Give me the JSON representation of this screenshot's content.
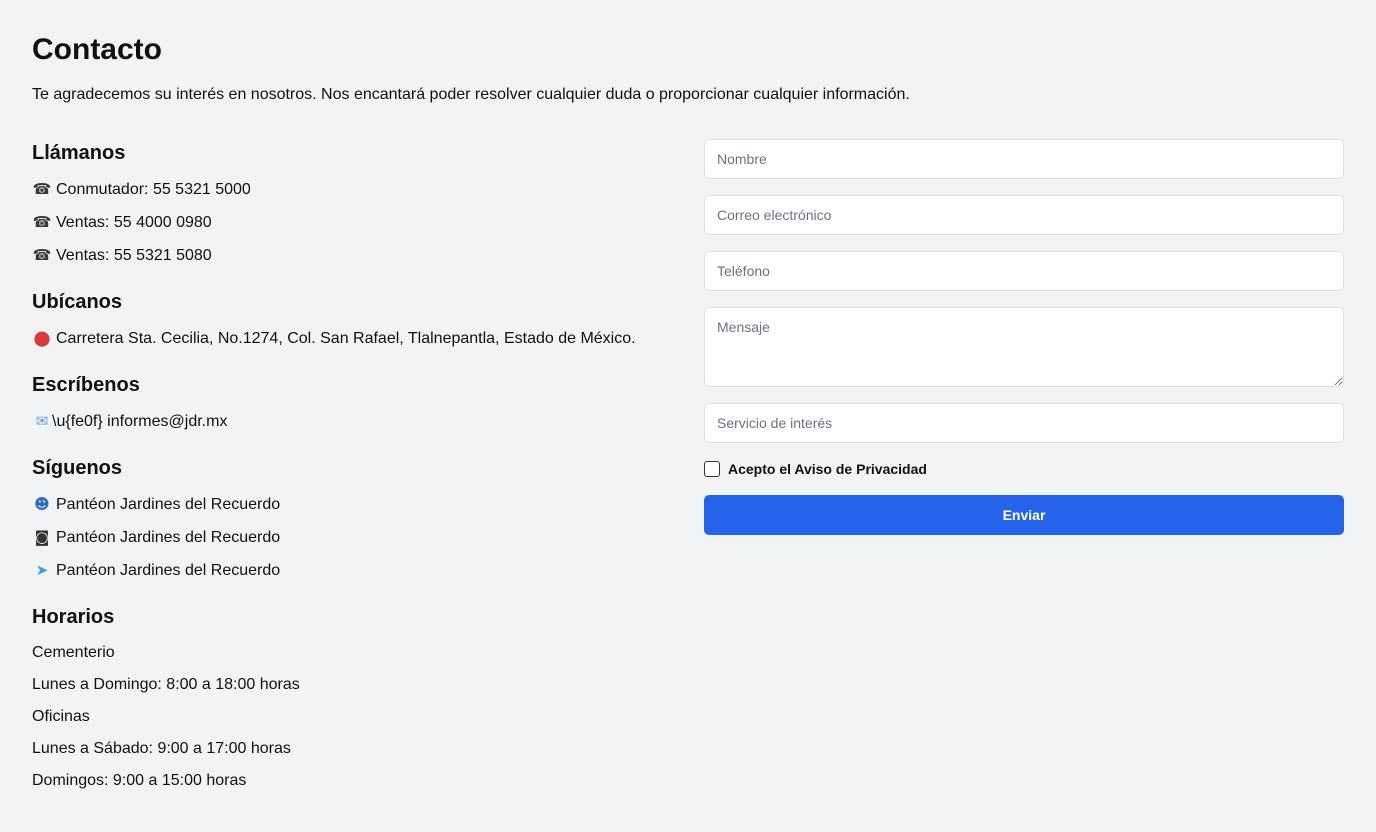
{
  "page": {
    "title": "Contacto",
    "intro": "Te agradecemos su interés en nosotros. Nos encantará poder resolver cualquier duda o proporcionar cualquier información."
  },
  "call": {
    "heading": "Llámanos",
    "icon": "phone-icon",
    "lines": [
      "Conmutador: 55 5321 5000",
      "Ventas: 55 4000 0980",
      "Ventas: 55 5321 5080"
    ]
  },
  "location": {
    "heading": "Ubícanos",
    "icon": "location-pin-icon",
    "address": "Carretera Sta. Cecilia, No.1274, Col. San Rafael, Tlalnepantla, Estado de México."
  },
  "write": {
    "heading": "Escríbenos",
    "icon": "envelope-icon",
    "raw_escape": "\\u{fe0f}",
    "email": "informes@jdr.mx"
  },
  "follow": {
    "heading": "Síguenos",
    "items": [
      {
        "icon": "person-icon",
        "label": "Pantéon Jardines del Recuerdo"
      },
      {
        "icon": "camera-icon",
        "label": "Pantéon Jardines del Recuerdo"
      },
      {
        "icon": "bird-icon",
        "label": "Pantéon Jardines del Recuerdo"
      }
    ]
  },
  "hours": {
    "heading": "Horarios",
    "lines": [
      "Cementerio",
      "Lunes a Domingo: 8:00 a 18:00 horas",
      "Oficinas",
      "Lunes a Sábado: 9:00 a 17:00 horas",
      "Domingos: 9:00 a 15:00 horas"
    ]
  },
  "form": {
    "name_placeholder": "Nombre",
    "email_placeholder": "Correo electrónico",
    "phone_placeholder": "Teléfono",
    "message_placeholder": "Mensaje",
    "service_placeholder": "Servicio de interés",
    "privacy_label": "Acepto el Aviso de Privacidad",
    "privacy_checked": false,
    "submit_label": "Enviar"
  },
  "colors": {
    "background": "#f2f3f5",
    "primary": "#2563eb",
    "field_border": "#dcdfe4"
  }
}
